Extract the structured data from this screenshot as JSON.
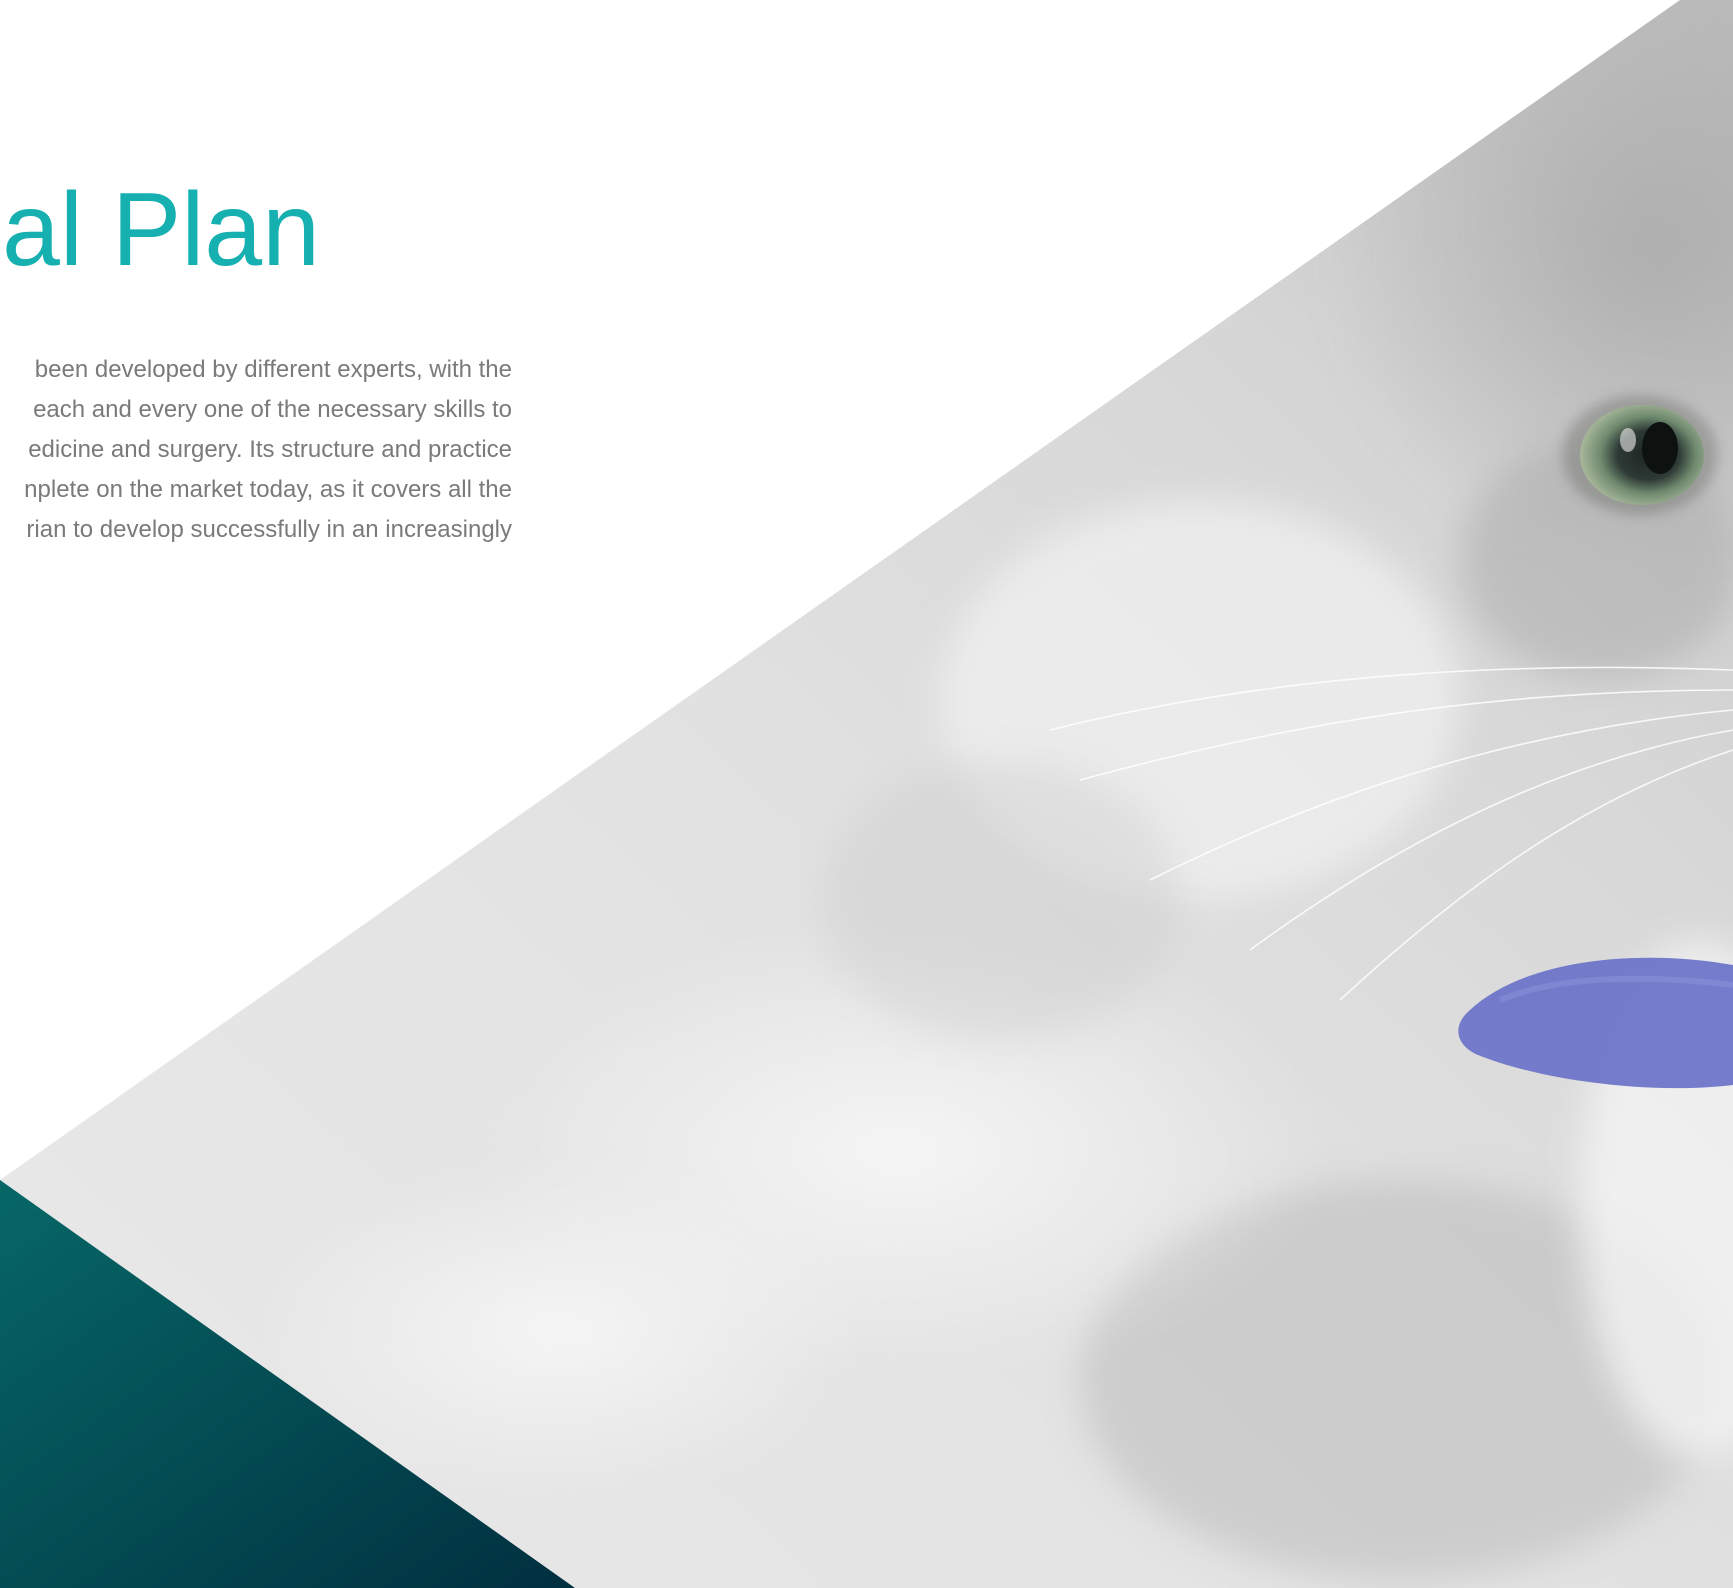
{
  "section": {
    "title": "nal Plan",
    "description_lines": [
      "been developed by different experts, with the",
      "each and every one of the necessary skills to",
      "edicine and surgery. Its structure and practice",
      "nplete on the market today, as it covers all the",
      "rian to develop successfully in an increasingly"
    ]
  },
  "colors": {
    "accent": "#16b0b0",
    "body_text": "#7a7a7a",
    "teal_dark": "#013545",
    "teal_light": "#066767"
  },
  "photo": {
    "subject": "cat-photo",
    "collar_color": "#6a72c8"
  }
}
